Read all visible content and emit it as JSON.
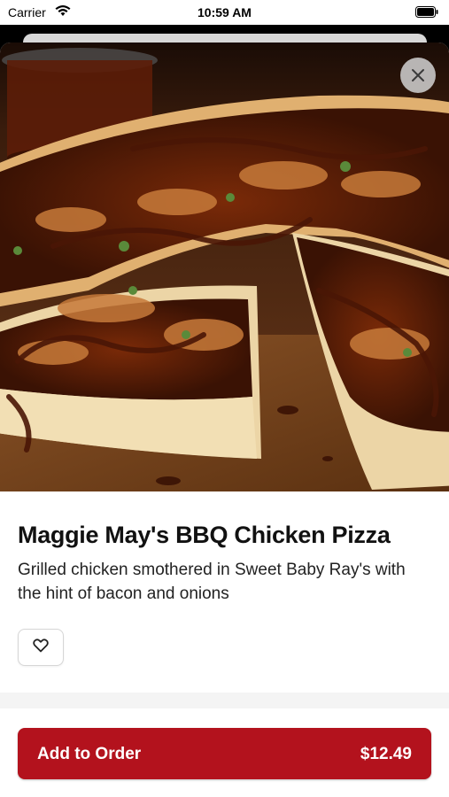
{
  "status_bar": {
    "carrier": "Carrier",
    "time": "10:59 AM"
  },
  "item": {
    "title": "Maggie May's BBQ Chicken Pizza",
    "description": "Grilled chicken smothered in Sweet Baby Ray's with the hint of bacon and onions",
    "image_icon": "bbq-chicken-pizza-photo"
  },
  "actions": {
    "close_icon": "close-icon",
    "favorite_icon": "heart-icon",
    "add_label": "Add to Order",
    "price": "$12.49"
  },
  "colors": {
    "primary": "#b3121d",
    "close_bg": "#d2d2d2"
  }
}
